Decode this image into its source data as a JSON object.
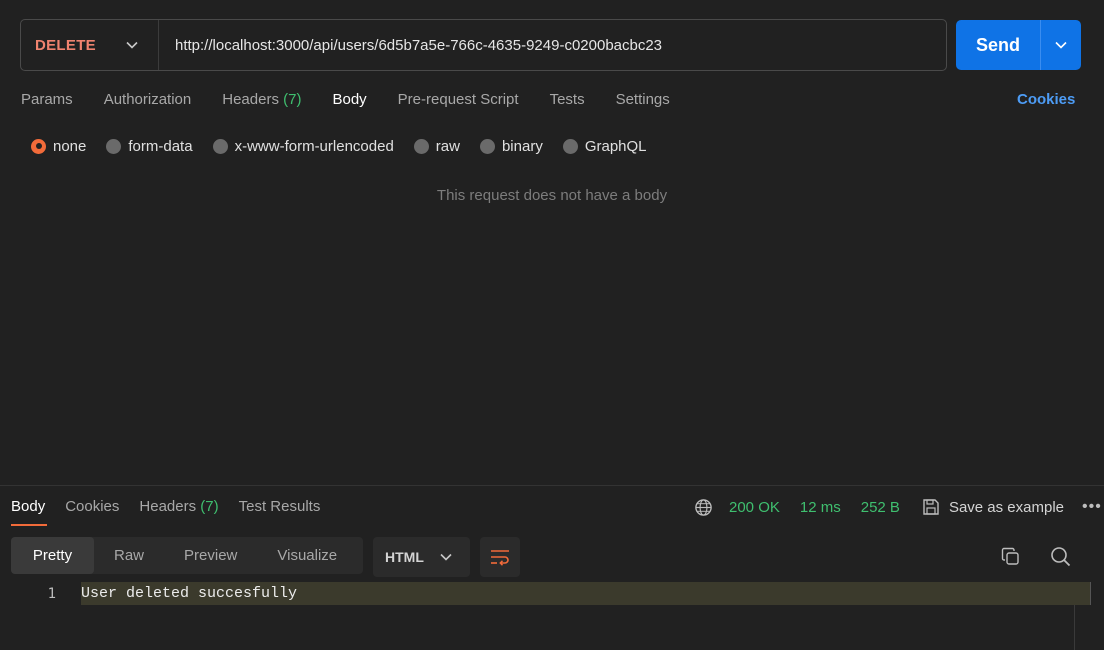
{
  "request": {
    "method": "DELETE",
    "url": "http://localhost:3000/api/users/6d5b7a5e-766c-4635-9249-c0200bacbc23",
    "send_label": "Send"
  },
  "request_tabs": {
    "params": "Params",
    "authorization": "Authorization",
    "headers": "Headers",
    "headers_count": "(7)",
    "body": "Body",
    "pre_request_script": "Pre-request Script",
    "tests": "Tests",
    "settings": "Settings",
    "cookies": "Cookies",
    "active": "Body"
  },
  "body_types": {
    "none": "none",
    "form_data": "form-data",
    "urlencoded": "x-www-form-urlencoded",
    "raw": "raw",
    "binary": "binary",
    "graphql": "GraphQL",
    "selected": "none"
  },
  "empty_body_message": "This request does not have a body",
  "response": {
    "tabs": {
      "body": "Body",
      "cookies": "Cookies",
      "headers": "Headers",
      "headers_count": "(7)",
      "test_results": "Test Results"
    },
    "status": "200 OK",
    "time": "12 ms",
    "size": "252 B",
    "save_as_example": "Save as example",
    "more": "•••",
    "views": {
      "pretty": "Pretty",
      "raw": "Raw",
      "preview": "Preview",
      "visualize": "Visualize",
      "active": "Pretty"
    },
    "format": "HTML",
    "lines": [
      {
        "number": "1",
        "content": "User deleted succesfully"
      }
    ]
  },
  "colors": {
    "accent": "#f26b3a",
    "send_button": "#0f73e6",
    "method_delete": "#f0836f",
    "status_ok": "#3fbf6f",
    "link": "#4d9cf5"
  }
}
